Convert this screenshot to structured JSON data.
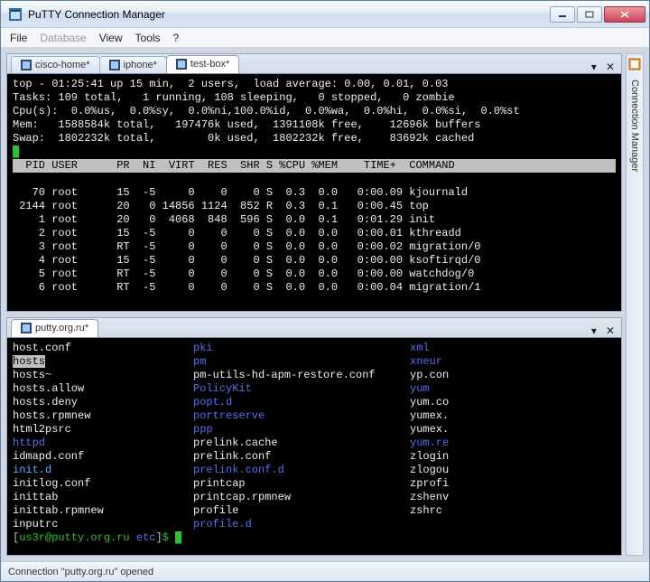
{
  "window": {
    "title": "PuTTY Connection Manager"
  },
  "menu": {
    "file": "File",
    "database": "Database",
    "view": "View",
    "tools": "Tools",
    "help": "?"
  },
  "sidepanel": {
    "label": "Connection Manager"
  },
  "panel1": {
    "tabs": [
      "cisco-home*",
      "iphone*",
      "test-box*"
    ],
    "active": 2,
    "top_lines": {
      "l1": "top - 01:25:41 up 15 min,  2 users,  load average: 0.00, 0.01, 0.03",
      "l2": "Tasks: 109 total,   1 running, 108 sleeping,   0 stopped,   0 zombie",
      "l3": "Cpu(s):  0.0%us,  0.0%sy,  0.0%ni,100.0%id,  0.0%wa,  0.0%hi,  0.0%si,  0.0%st",
      "l4": "Mem:   1588584k total,   197476k used,  1391108k free,    12696k buffers",
      "l5": "Swap:  1802232k total,        0k used,  1802232k free,    83692k cached"
    },
    "header": "  PID USER      PR  NI  VIRT  RES  SHR S %CPU %MEM    TIME+  COMMAND           ",
    "procs": [
      "   70 root      15  -5     0    0    0 S  0.3  0.0   0:00.09 kjournald",
      " 2144 root      20   0 14856 1124  852 R  0.3  0.1   0:00.45 top",
      "    1 root      20   0  4068  848  596 S  0.0  0.1   0:01.29 init",
      "    2 root      15  -5     0    0    0 S  0.0  0.0   0:00.01 kthreadd",
      "    3 root      RT  -5     0    0    0 S  0.0  0.0   0:00.02 migration/0",
      "    4 root      15  -5     0    0    0 S  0.0  0.0   0:00.00 ksoftirqd/0",
      "    5 root      RT  -5     0    0    0 S  0.0  0.0   0:00.00 watchdog/0",
      "    6 root      RT  -5     0    0    0 S  0.0  0.0   0:00.04 migration/1"
    ]
  },
  "panel2": {
    "tabs": [
      "putty.org.ru*"
    ],
    "ls": [
      {
        "c1": {
          "t": "host.conf",
          "c": "w"
        },
        "c2": {
          "t": "pki",
          "c": "b"
        },
        "c3": {
          "t": "xml",
          "c": "b"
        }
      },
      {
        "c1": {
          "t": "hosts",
          "c": "sel"
        },
        "c2": {
          "t": "pm",
          "c": "b"
        },
        "c3": {
          "t": "xneur",
          "c": "b"
        }
      },
      {
        "c1": {
          "t": "hosts~",
          "c": "w"
        },
        "c2": {
          "t": "pm-utils-hd-apm-restore.conf",
          "c": "w"
        },
        "c3": {
          "t": "yp.con",
          "c": "w"
        }
      },
      {
        "c1": {
          "t": "hosts.allow",
          "c": "w"
        },
        "c2": {
          "t": "PolicyKit",
          "c": "b"
        },
        "c3": {
          "t": "yum",
          "c": "b"
        }
      },
      {
        "c1": {
          "t": "hosts.deny",
          "c": "w"
        },
        "c2": {
          "t": "popt.d",
          "c": "b"
        },
        "c3": {
          "t": "yum.co",
          "c": "w"
        }
      },
      {
        "c1": {
          "t": "hosts.rpmnew",
          "c": "w"
        },
        "c2": {
          "t": "portreserve",
          "c": "b"
        },
        "c3": {
          "t": "yumex.",
          "c": "w"
        }
      },
      {
        "c1": {
          "t": "html2psrc",
          "c": "w"
        },
        "c2": {
          "t": "ppp",
          "c": "b"
        },
        "c3": {
          "t": "yumex.",
          "c": "w"
        }
      },
      {
        "c1": {
          "t": "httpd",
          "c": "b"
        },
        "c2": {
          "t": "prelink.cache",
          "c": "w"
        },
        "c3": {
          "t": "yum.re",
          "c": "b"
        }
      },
      {
        "c1": {
          "t": "idmapd.conf",
          "c": "w"
        },
        "c2": {
          "t": "prelink.conf",
          "c": "w"
        },
        "c3": {
          "t": "zlogin",
          "c": "w"
        }
      },
      {
        "c1": {
          "t": "init.d",
          "c": "lb"
        },
        "c2": {
          "t": "prelink.conf.d",
          "c": "b"
        },
        "c3": {
          "t": "zlogou",
          "c": "w"
        }
      },
      {
        "c1": {
          "t": "initlog.conf",
          "c": "w"
        },
        "c2": {
          "t": "printcap",
          "c": "w"
        },
        "c3": {
          "t": "zprofi",
          "c": "w"
        }
      },
      {
        "c1": {
          "t": "inittab",
          "c": "w"
        },
        "c2": {
          "t": "printcap.rpmnew",
          "c": "w"
        },
        "c3": {
          "t": "zshenv",
          "c": "w"
        }
      },
      {
        "c1": {
          "t": "inittab.rpmnew",
          "c": "w"
        },
        "c2": {
          "t": "profile",
          "c": "w"
        },
        "c3": {
          "t": "zshrc",
          "c": "w"
        }
      },
      {
        "c1": {
          "t": "inputrc",
          "c": "w"
        },
        "c2": {
          "t": "profile.d",
          "c": "b"
        },
        "c3": {
          "t": "",
          "c": "w"
        }
      }
    ],
    "prompt": {
      "user": "us3r@putty.org.ru",
      "path": "etc",
      "sym": "$"
    }
  },
  "status": {
    "text": "Connection \"putty.org.ru\" opened"
  }
}
